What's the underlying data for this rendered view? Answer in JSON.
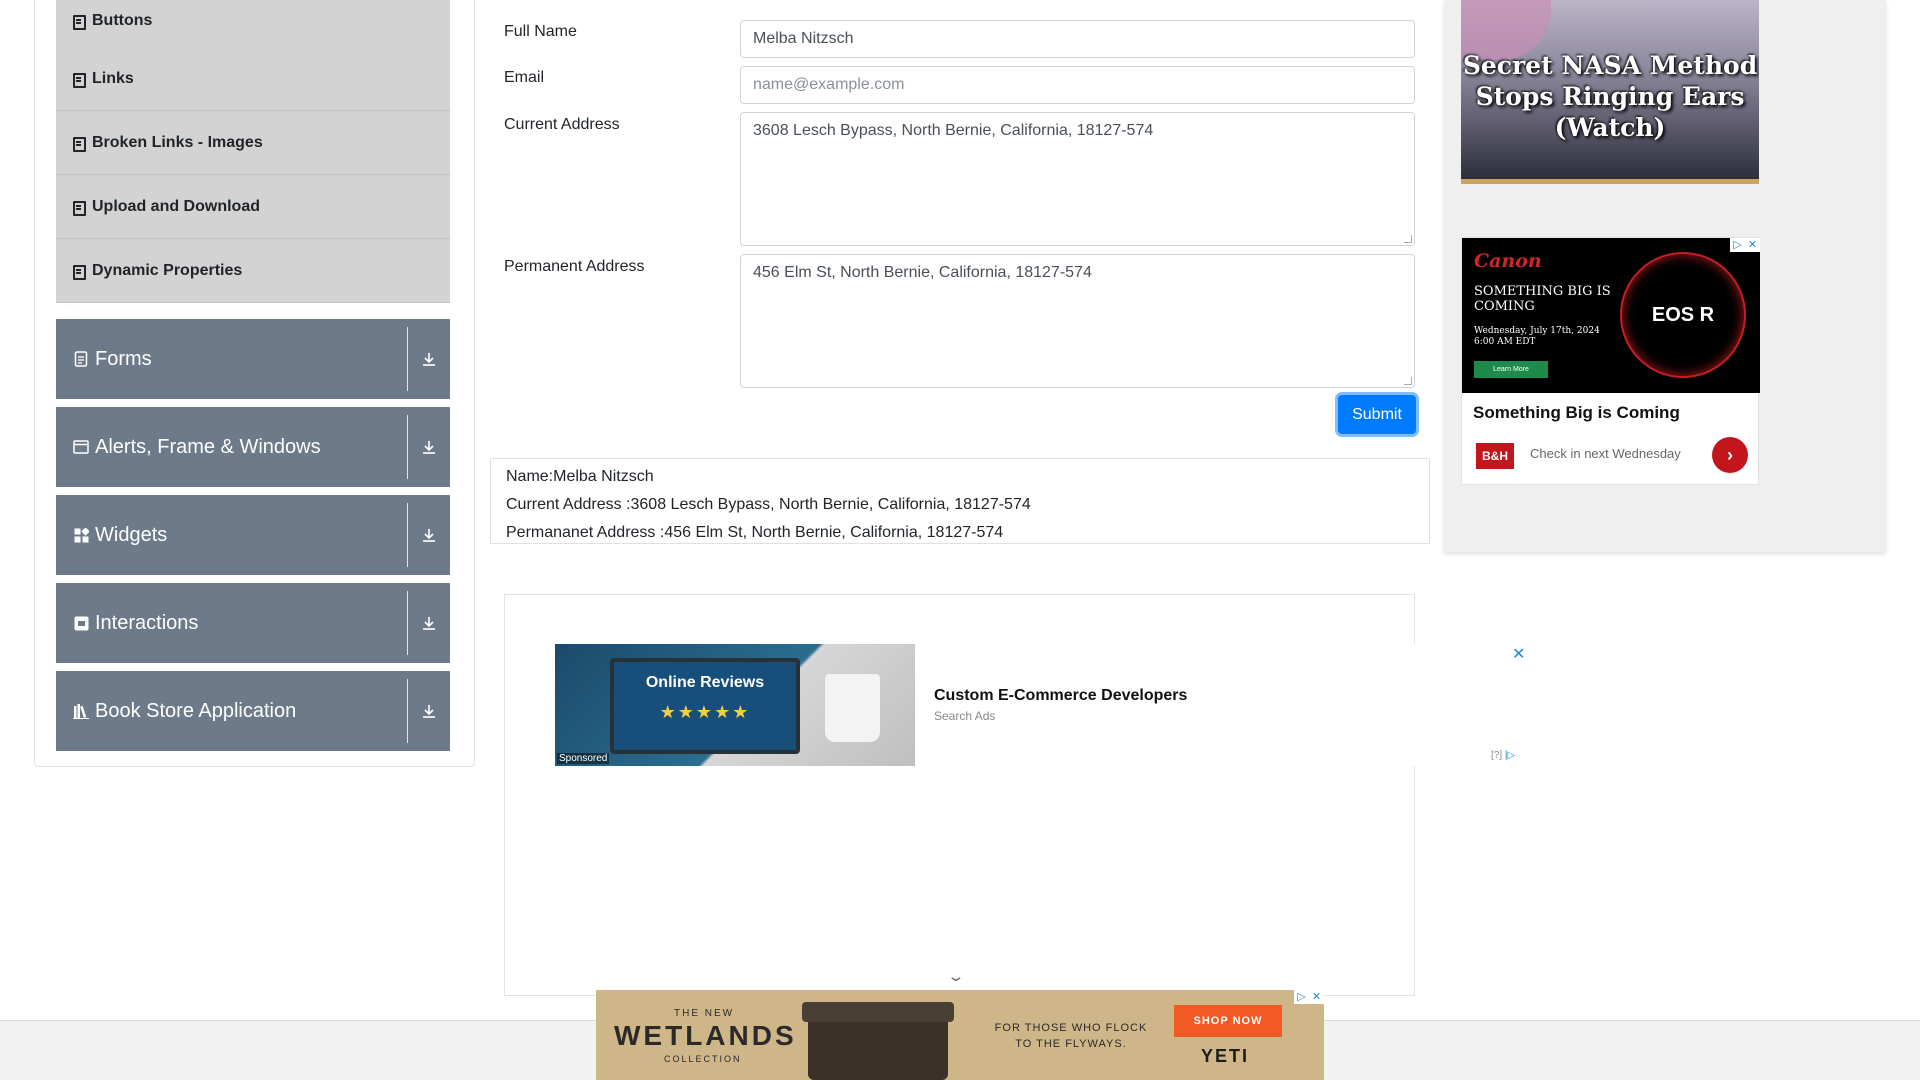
{
  "sidebar": {
    "sub_items": [
      {
        "label": "Buttons"
      },
      {
        "label": "Links"
      },
      {
        "label": "Broken Links - Images"
      },
      {
        "label": "Upload and Download"
      },
      {
        "label": "Dynamic Properties"
      }
    ],
    "groups": [
      {
        "label": "Forms",
        "icon": "document-icon"
      },
      {
        "label": "Alerts, Frame & Windows",
        "icon": "window-icon"
      },
      {
        "label": "Widgets",
        "icon": "widgets-icon"
      },
      {
        "label": "Interactions",
        "icon": "interactions-icon"
      },
      {
        "label": "Book Store Application",
        "icon": "books-icon"
      }
    ]
  },
  "form": {
    "full_name_label": "Full Name",
    "full_name_value": "Melba Nitzsch",
    "email_label": "Email",
    "email_placeholder": "name@example.com",
    "current_address_label": "Current Address",
    "current_address_value": "3608 Lesch Bypass, North Bernie, California, 18127-574",
    "permanent_address_label": "Permanent Address",
    "permanent_address_value": "456 Elm St, North Bernie, California, 18127-574",
    "submit_label": "Submit"
  },
  "output": {
    "name": "Name:Melba Nitzsch",
    "current_address": "Current Address :3608 Lesch Bypass, North Bernie, California, 18127-574",
    "permanent_address": "Permananet Address :456 Elm St, North Bernie, California, 18127-574"
  },
  "center_ad": {
    "image_title": "Online Reviews",
    "stars": "★★★★★",
    "sponsored": "Sponsored",
    "title": "Custom E-Commerce Developers",
    "subtitle": "Search Ads",
    "close": "✕",
    "info": "[?]"
  },
  "right_ads": {
    "ad1_title": "Secret NASA Method Stops Ringing Ears (Watch)",
    "canon_brand": "Canon",
    "canon_tagline": "SOMETHING BIG IS COMING",
    "canon_date": "Wednesday, July 17th, 2024 6:00 AM EDT",
    "canon_learn": "Learn More",
    "canon_model": "EOS R",
    "ad2_headline": "Something Big is Coming",
    "bh_logo": "B&H",
    "ad2_checkin": "Check in next Wednesday"
  },
  "bottom_ad": {
    "the_new": "THE NEW",
    "wetlands": "WETLANDS",
    "collection": "COLLECTION",
    "flock": "FOR THOSE WHO FLOCK TO THE FLYWAYS.",
    "shop_now": "SHOP NOW",
    "brand": "YETI"
  },
  "colors": {
    "accent": "#007bff",
    "sidebar_group": "#6c7a89",
    "sidebar_sub": "#d3d3d3"
  }
}
